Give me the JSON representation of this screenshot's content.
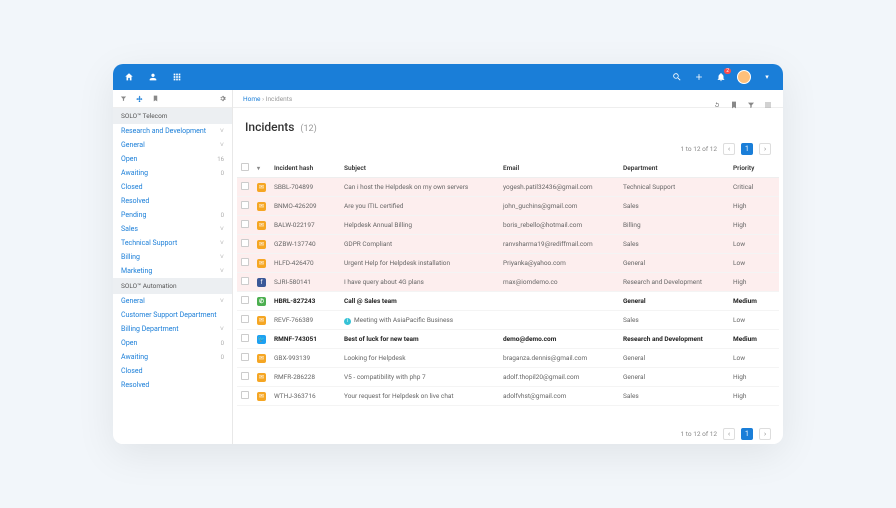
{
  "topbar": {
    "notification_count": "2"
  },
  "sidebar": {
    "sections": [
      {
        "title": "SOLO™ Telecom",
        "items": [
          {
            "label": "Research and Development",
            "expandable": true
          },
          {
            "label": "General",
            "expandable": true
          },
          {
            "label": "Open",
            "count": "16"
          },
          {
            "label": "Awaiting",
            "count": "0"
          },
          {
            "label": "Closed"
          },
          {
            "label": "Resolved"
          },
          {
            "label": "Pending",
            "count": "0"
          },
          {
            "label": "Sales",
            "expandable": true
          },
          {
            "label": "Technical Support",
            "expandable": true
          },
          {
            "label": "Billing",
            "expandable": true
          },
          {
            "label": "Marketing",
            "expandable": true
          }
        ]
      },
      {
        "title": "SOLO™ Automation",
        "items": [
          {
            "label": "General",
            "expandable": true
          },
          {
            "label": "Customer Support Department"
          },
          {
            "label": "Billing Department",
            "expandable": true
          },
          {
            "label": "Open",
            "count": "0"
          },
          {
            "label": "Awaiting",
            "count": "0"
          },
          {
            "label": "Closed"
          },
          {
            "label": "Resolved"
          }
        ]
      }
    ]
  },
  "breadcrumb": {
    "home": "Home",
    "sep": "›",
    "current": "Incidents"
  },
  "page": {
    "title": "Incidents",
    "count": "(12)"
  },
  "pager": {
    "range": "1 to 12 of 12",
    "current": "1"
  },
  "columns": {
    "hash": "Incident hash",
    "subject": "Subject",
    "email": "Email",
    "department": "Department",
    "priority": "Priority"
  },
  "rows": [
    {
      "type": "envelope",
      "bold": false,
      "pink": true,
      "hash": "SBBL-704899",
      "subject": "Can i host the Helpdesk on my own servers",
      "email": "yogesh.patil32436@gmail.com",
      "dept": "Technical Support",
      "priority": "Critical",
      "pclass": "p-critical"
    },
    {
      "type": "envelope",
      "bold": false,
      "pink": true,
      "hash": "BNMO-426209",
      "subject": "Are you ITIL certified",
      "email": "john_guchins@gmail.com",
      "dept": "Sales",
      "priority": "High",
      "pclass": "p-high"
    },
    {
      "type": "envelope",
      "bold": false,
      "pink": true,
      "hash": "BALW-022197",
      "subject": "Helpdesk Annual Billing",
      "email": "boris_rebello@hotmail.com",
      "dept": "Billing",
      "priority": "High",
      "pclass": "p-high"
    },
    {
      "type": "envelope",
      "bold": false,
      "pink": true,
      "hash": "GZBW-137740",
      "subject": "GDPR Compliant",
      "email": "ranvsharma19@rediffmail.com",
      "dept": "Sales",
      "priority": "Low",
      "pclass": "p-low"
    },
    {
      "type": "envelope",
      "bold": false,
      "pink": true,
      "hash": "HLFD-426470",
      "subject": "Urgent Help for Helpdesk installation",
      "email": "Priyanka@yahoo.com",
      "dept": "General",
      "priority": "Low",
      "pclass": "p-low"
    },
    {
      "type": "fb",
      "bold": false,
      "pink": true,
      "hash": "SJRI-580141",
      "subject": "I have query about 4G plans",
      "email": "max@iomdemo.co",
      "dept": "Research and Development",
      "priority": "High",
      "pclass": "p-high"
    },
    {
      "type": "phone",
      "bold": true,
      "pink": false,
      "hash": "HBRL-827243",
      "subject": "Call @ Sales team",
      "email": "",
      "dept": "General",
      "priority": "Medium",
      "pclass": "p-medium"
    },
    {
      "type": "envelope",
      "bold": false,
      "pink": false,
      "hash": "REVF-766389",
      "subject": "Meeting with AsiaPacific Business",
      "info": true,
      "email": "",
      "dept": "Sales",
      "priority": "Low",
      "pclass": "p-low"
    },
    {
      "type": "tw",
      "bold": true,
      "pink": false,
      "hash": "RMNF-743051",
      "subject": "Best of luck for new team",
      "email": "demo@demo.com",
      "dept": "Research and Development",
      "priority": "Medium",
      "pclass": "p-medium"
    },
    {
      "type": "envelope",
      "bold": false,
      "pink": false,
      "hash": "GBX-993139",
      "subject": "Looking for Helpdesk",
      "email": "braganza.dennis@gmail.com",
      "dept": "General",
      "priority": "Low",
      "pclass": "p-low"
    },
    {
      "type": "envelope",
      "bold": false,
      "pink": false,
      "hash": "RMFR-286228",
      "subject": "V5 - compatibility with php 7",
      "email": "adolf.thopil20@gmail.com",
      "dept": "General",
      "priority": "High",
      "pclass": "p-high"
    },
    {
      "type": "envelope",
      "bold": false,
      "pink": false,
      "hash": "WTHJ-363716",
      "subject": "Your request for Helpdesk on live chat",
      "email": "adolfvhst@gmail.com",
      "dept": "Sales",
      "priority": "High",
      "pclass": "p-high"
    }
  ]
}
